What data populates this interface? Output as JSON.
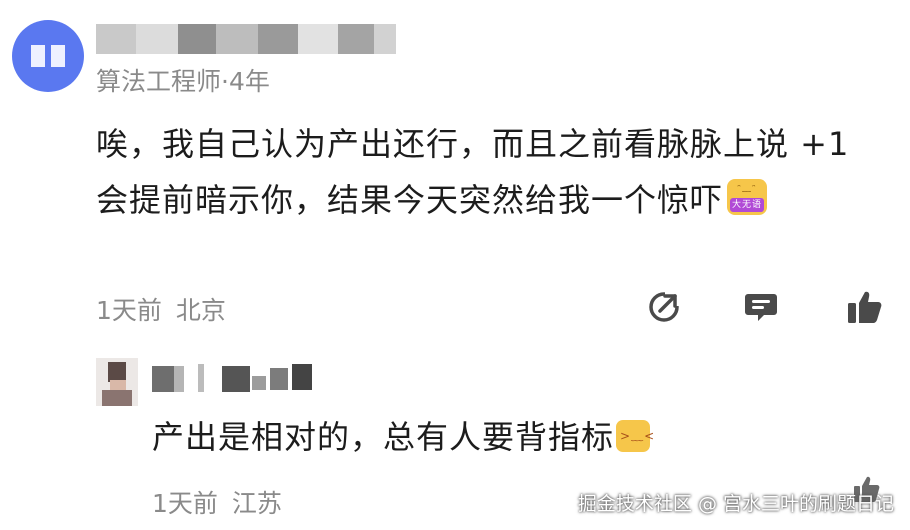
{
  "comment": {
    "meta": "算法工程师·4年",
    "text": "唉，我自己认为产出还行，而且之前看脉脉上说 +1 会提前暗示你，结果今天突然给我一个惊吓",
    "sticker_label": "大无语",
    "time": "1天前",
    "location": "北京",
    "icons": [
      "share-icon",
      "comment-icon",
      "like-icon"
    ],
    "accent_color": "#5a78f0"
  },
  "reply": {
    "text": "产出是相对的，总有人要背指标",
    "time": "1天前",
    "location": "江苏"
  },
  "watermark": "掘金技术社区 @ 宫水三叶的刷题日记"
}
